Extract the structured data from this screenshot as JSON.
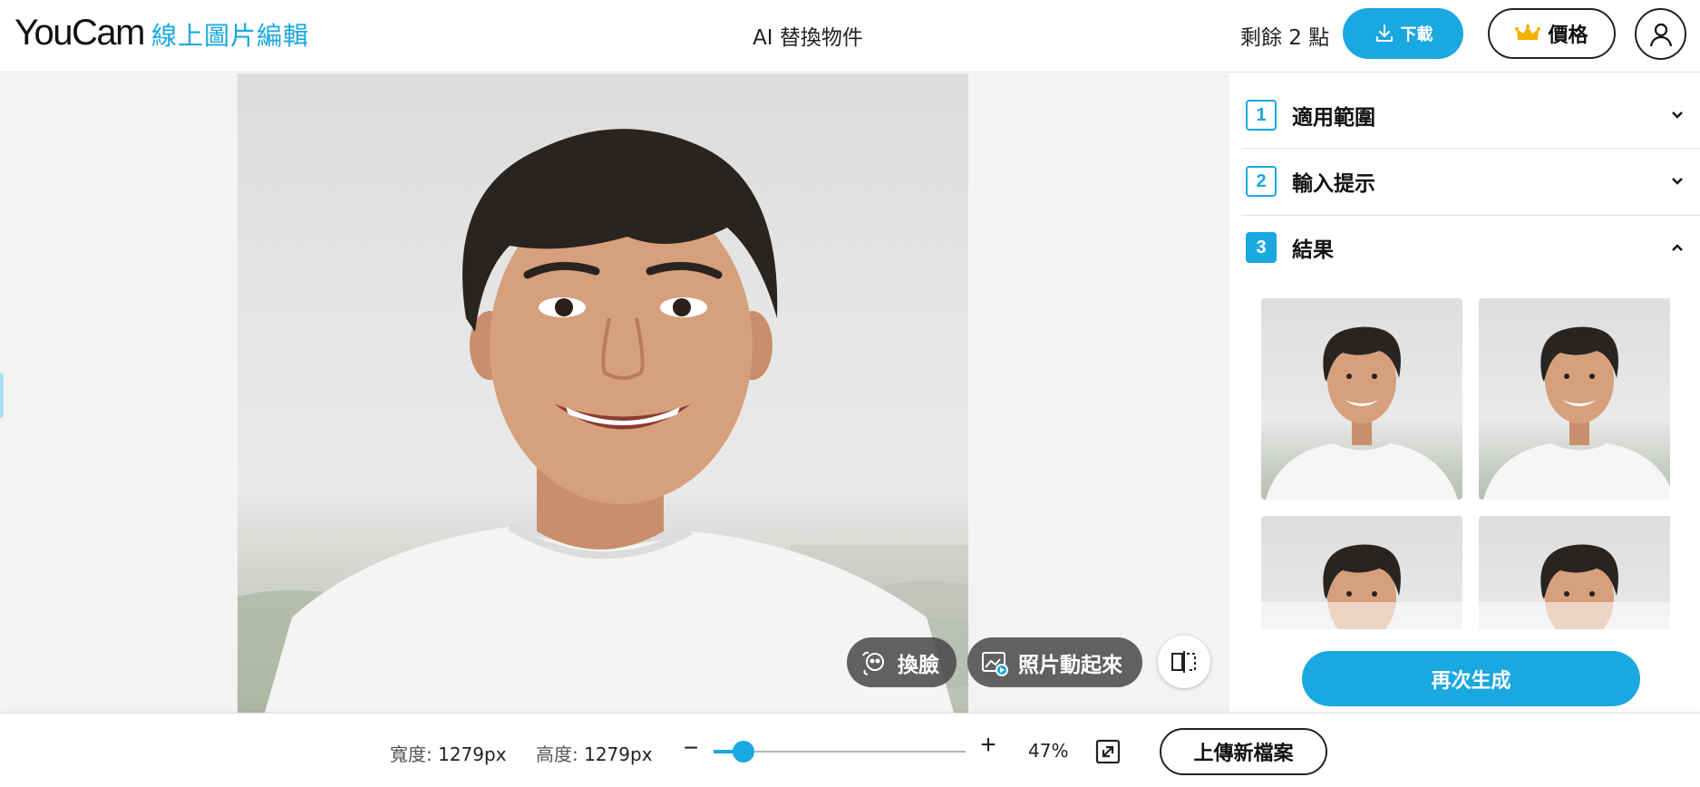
{
  "header": {
    "logo_text": "YouCam",
    "logo_sub": "線上圖片編輯",
    "tool_title": "AI 替換物件",
    "points_label": "剩餘 2 點",
    "download_label": "下載",
    "price_label": "價格",
    "icons": {
      "download": "download-icon",
      "crown": "crown-icon",
      "account": "user-icon"
    }
  },
  "canvas": {
    "image_description_icon": "portrait-photo",
    "buttons": {
      "face_swap": "換臉",
      "animate_photo": "照片動起來",
      "compare_icon": "compare-split-icon"
    }
  },
  "panel": {
    "steps": [
      {
        "num": "1",
        "label": "適用範圍",
        "expanded": false
      },
      {
        "num": "2",
        "label": "輸入提示",
        "expanded": false
      },
      {
        "num": "3",
        "label": "結果",
        "expanded": true
      }
    ],
    "result_count_visible": 4,
    "regenerate_label": "再次生成"
  },
  "bottombar": {
    "width_label": "寬度:",
    "width_value": "1279px",
    "height_label": "高度:",
    "height_value": "1279px",
    "zoom_minus": "−",
    "zoom_plus": "+",
    "zoom_value": "47%",
    "zoom_fraction": 0.12,
    "upload_label": "上傳新檔案"
  },
  "colors": {
    "accent": "#1aa8e0",
    "text": "#111111",
    "canvas_bg": "#f3f3f3",
    "pill_bg": "#464646"
  }
}
